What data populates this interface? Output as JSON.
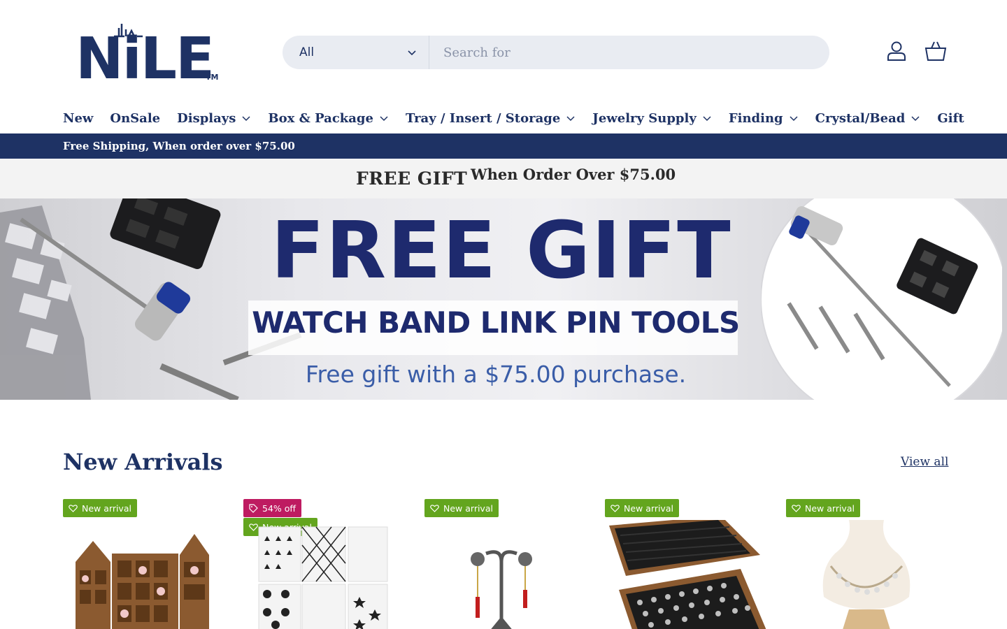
{
  "brand": {
    "logo_text": "NiLE",
    "logo_mark": "TM",
    "navy": "#1e3264",
    "badge_green": "#63a51e",
    "badge_pink": "#be1b61"
  },
  "search": {
    "category_selected": "All",
    "placeholder": "Search for"
  },
  "header_icons": [
    "account-icon",
    "cart-icon"
  ],
  "nav": {
    "items": [
      {
        "label": "New",
        "has_dropdown": false
      },
      {
        "label": "OnSale",
        "has_dropdown": false
      },
      {
        "label": "Displays",
        "has_dropdown": true
      },
      {
        "label": "Box & Package",
        "has_dropdown": true
      },
      {
        "label": "Tray / Insert / Storage",
        "has_dropdown": true
      },
      {
        "label": "Jewelry Supply",
        "has_dropdown": true
      },
      {
        "label": "Finding",
        "has_dropdown": true
      },
      {
        "label": "Crystal/Bead",
        "has_dropdown": true
      },
      {
        "label": "Gift",
        "has_dropdown": false
      }
    ]
  },
  "announcement": {
    "shipping": "Free Shipping, When order over $75.00"
  },
  "gift_strip": {
    "label": "FREE GIFT",
    "condition": "When Order Over $75.00"
  },
  "banner": {
    "title": "FREE GIFT",
    "subtitle": "WATCH BAND LINK PIN TOOLS",
    "note": "Free gift with a $75.00 purchase."
  },
  "new_arrivals": {
    "title": "New Arrivals",
    "view_all": "View all",
    "products": [
      {
        "badges": [
          "New arrival"
        ],
        "discount": null
      },
      {
        "badges": [
          "New arrival"
        ],
        "discount": "54% off"
      },
      {
        "badges": [
          "New arrival"
        ],
        "discount": null
      },
      {
        "badges": [
          "New arrival"
        ],
        "discount": null
      },
      {
        "badges": [
          "New arrival"
        ],
        "discount": null
      }
    ]
  }
}
